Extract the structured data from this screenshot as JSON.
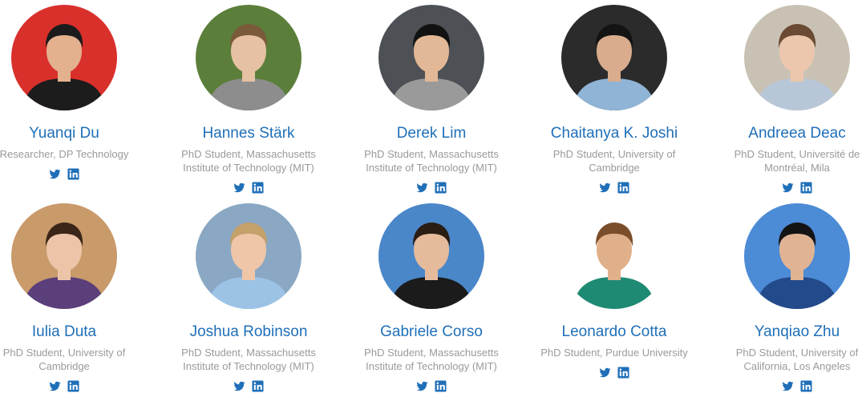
{
  "people": [
    {
      "name": "Yuanqi Du",
      "title": "Researcher, DP Technology",
      "twitter_icon": "twitter-icon",
      "linkedin_icon": "linkedin-icon",
      "bg": "#d9302c",
      "skin": "#e3b18e",
      "hair": "#1b1b1b",
      "shirt": "#1c1c1c"
    },
    {
      "name": "Hannes Stärk",
      "title": "PhD Student, Massachusetts\nInstitute of Technology (MIT)",
      "twitter_icon": "twitter-icon",
      "linkedin_icon": "linkedin-icon",
      "bg": "#5b7f3a",
      "skin": "#e6c1a3",
      "hair": "#7a5a3a",
      "shirt": "#8d8d8d"
    },
    {
      "name": "Derek Lim",
      "title": "PhD Student, Massachusetts\nInstitute of Technology (MIT)",
      "twitter_icon": "twitter-icon",
      "linkedin_icon": "linkedin-icon",
      "bg": "#4d5055",
      "skin": "#e2b896",
      "hair": "#121212",
      "shirt": "#9a9a9a"
    },
    {
      "name": "Chaitanya K. Joshi",
      "title": "PhD Student, University of\nCambridge",
      "twitter_icon": "twitter-icon",
      "linkedin_icon": "linkedin-icon",
      "bg": "#2b2b2b",
      "skin": "#d8ac8c",
      "hair": "#141414",
      "shirt": "#8fb4d6"
    },
    {
      "name": "Andreea Deac",
      "title": "PhD Student, Université de\nMontréal, Mila",
      "twitter_icon": "twitter-icon",
      "linkedin_icon": "linkedin-icon",
      "bg": "#c9c2b4",
      "skin": "#ecc7ad",
      "hair": "#6a4a33",
      "shirt": "#b8c7d8"
    },
    {
      "name": "Iulia Duta",
      "title": "PhD Student, University of\nCambridge",
      "twitter_icon": "twitter-icon",
      "linkedin_icon": "linkedin-icon",
      "bg": "#c99a6a",
      "skin": "#edc4a8",
      "hair": "#3a2518",
      "shirt": "#5a3f7a"
    },
    {
      "name": "Joshua Robinson",
      "title": "PhD Student, Massachusetts\nInstitute of Technology (MIT)",
      "twitter_icon": "twitter-icon",
      "linkedin_icon": "linkedin-icon",
      "bg": "#8aa8c4",
      "skin": "#efc6a8",
      "hair": "#c4a06a",
      "shirt": "#9cc3e6"
    },
    {
      "name": "Gabriele Corso",
      "title": "PhD Student, Massachusetts\nInstitute of Technology (MIT)",
      "twitter_icon": "twitter-icon",
      "linkedin_icon": "linkedin-icon",
      "bg": "#4a87c9",
      "skin": "#e5bb9c",
      "hair": "#2a1d14",
      "shirt": "#1b1b1b"
    },
    {
      "name": "Leonardo Cotta",
      "title": "PhD Student, Purdue University",
      "twitter_icon": "twitter-icon",
      "linkedin_icon": "linkedin-icon",
      "bg": "#ffffff",
      "skin": "#e0b08a",
      "hair": "#7a4e2a",
      "shirt": "#1f8a74"
    },
    {
      "name": "Yanqiao Zhu",
      "title": "PhD Student, University of\nCalifornia, Los Angeles",
      "twitter_icon": "twitter-icon",
      "linkedin_icon": "linkedin-icon",
      "bg": "#4c8bd6",
      "skin": "#e0b492",
      "hair": "#141414",
      "shirt": "#234a8a"
    }
  ],
  "colors": {
    "name": "#1f6fb8",
    "title": "#9a9a9a",
    "icon": "#1f6fb8"
  }
}
